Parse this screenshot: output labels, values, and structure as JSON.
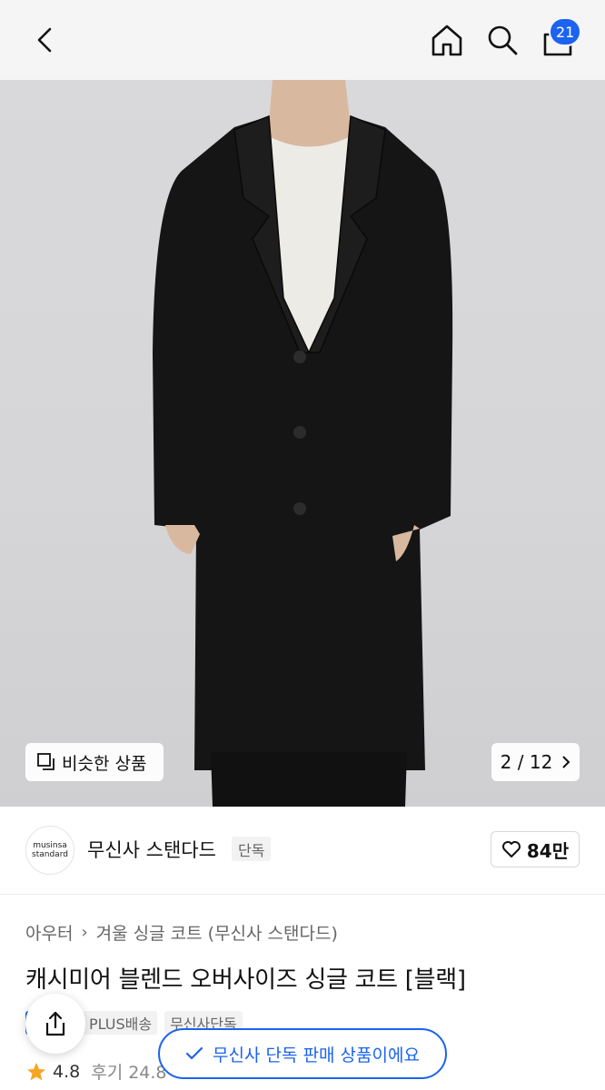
{
  "header": {
    "cart_count": "21",
    "icons": [
      "back-chevron-icon",
      "home-icon",
      "search-icon",
      "cart-icon"
    ]
  },
  "gallery": {
    "similar_label": "비슷한 상품",
    "current": "2",
    "total": "12",
    "pager_text": "2 / 12"
  },
  "brand": {
    "logo_line1": "musinsa",
    "logo_line2": "standard",
    "name": "무신사 스탠다드",
    "tag": "단독",
    "likes": "84만"
  },
  "product": {
    "breadcrumb": [
      "아우터",
      "겨울 싱글 코트 (무신사 스탠다드)"
    ],
    "title": "캐시미어 블렌드 오버사이즈 싱글 코트 [블랙]",
    "chips": [
      "PLUS배송",
      "무신사단독"
    ],
    "rating": "4.8",
    "reviews": "후기 24.8"
  },
  "toast": {
    "message": "무신사 단독 판매 상품이에요"
  },
  "colors": {
    "accent": "#1b63f0",
    "star": "#f5a623"
  }
}
